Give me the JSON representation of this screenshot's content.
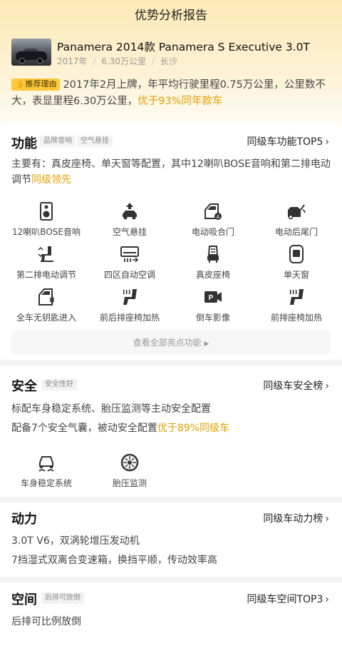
{
  "header": {
    "title": "优势分析报告"
  },
  "car": {
    "title": "Panamera 2014款 Panamera S Executive 3.0T",
    "year": "2017年",
    "mileage": "6.30万公里",
    "city": "长沙",
    "sep": "/"
  },
  "reason": {
    "badge": "推荐理由",
    "text": "2017年2月上牌，年平均行驶里程0.75万公里，公里数不大，表显里程6.30万公里，",
    "highlight": "优于93%同年款车"
  },
  "function": {
    "title": "功能",
    "tags": [
      "品牌音响",
      "空气悬挂"
    ],
    "link": "同级车功能TOP5",
    "desc": "主要有：真皮座椅、单天窗等配置，其中12喇叭BOSE音响和第二排电动调节",
    "desc_highlight": "同级领先",
    "items": [
      {
        "label": "12喇叭BOSE音响",
        "icon": "speaker-icon"
      },
      {
        "label": "空气悬挂",
        "icon": "air-suspension-icon"
      },
      {
        "label": "电动吸合门",
        "icon": "soft-close-door-icon"
      },
      {
        "label": "电动后尾门",
        "icon": "power-tailgate-icon"
      },
      {
        "label": "第二排电动调节",
        "icon": "seat-adjust-icon"
      },
      {
        "label": "四区自动空调",
        "icon": "air-conditioner-icon"
      },
      {
        "label": "真皮座椅",
        "icon": "leather-seat-icon"
      },
      {
        "label": "单天窗",
        "icon": "sunroof-icon"
      },
      {
        "label": "全车无钥匙进入",
        "icon": "keyless-entry-icon"
      },
      {
        "label": "前后排座椅加热",
        "icon": "seat-heating-icon"
      },
      {
        "label": "倒车影像",
        "icon": "reverse-camera-icon"
      },
      {
        "label": "前排座椅加热",
        "icon": "front-seat-heating-icon"
      }
    ],
    "view_all": "查看全部亮点功能"
  },
  "safety": {
    "title": "安全",
    "tag": "安全性好",
    "link": "同级车安全榜",
    "line1": "标配车身稳定系统、胎压监测等主动安全配置",
    "line2": "配备7个安全气囊，被动安全配置",
    "line2_highlight": "优于89%同级车",
    "items": [
      {
        "label": "车身稳定系统",
        "icon": "stability-control-icon"
      },
      {
        "label": "胎压监测",
        "icon": "tire-pressure-icon"
      }
    ]
  },
  "power": {
    "title": "动力",
    "link": "同级车动力榜",
    "line1": "3.0T V6，双涡轮增压发动机",
    "line2": "7挡湿式双离合变速箱，换挡平顺，传动效率高"
  },
  "space": {
    "title": "空间",
    "tag": "后排可放倒",
    "link": "同级车空间TOP3",
    "line1": "后排可比例放倒"
  },
  "colors": {
    "accent": "#fbc93a",
    "highlight": "#e0a100",
    "bg_top": "#fde9b5"
  }
}
